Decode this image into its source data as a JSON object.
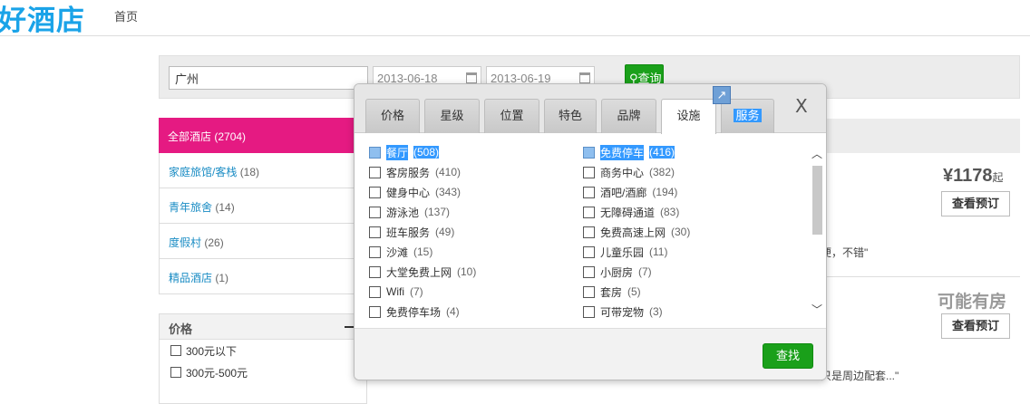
{
  "header": {
    "logo": "好酒店",
    "nav_home": "首页"
  },
  "search": {
    "city_value": "广州",
    "checkin": "2013-06-18",
    "checkout": "2013-06-19",
    "button_label": "查询"
  },
  "categories": [
    {
      "label": "全部酒店",
      "count": "(2704)"
    },
    {
      "label": "家庭旅馆/客栈",
      "count": "(18)"
    },
    {
      "label": "青年旅舍",
      "count": "(14)"
    },
    {
      "label": "度假村",
      "count": "(26)"
    },
    {
      "label": "精品酒店",
      "count": "(1)"
    }
  ],
  "price_filter": {
    "title": "价格",
    "options": [
      "300元以下",
      "300元-500元"
    ]
  },
  "results": {
    "price1": "¥1178",
    "price1_suffix": "起",
    "book_label": "查看预订",
    "review1": "便，不错\"",
    "maybe_available": "可能有房",
    "review2": "只是周边配套...\""
  },
  "modal": {
    "tabs": [
      "价格",
      "星级",
      "位置",
      "特色",
      "品牌",
      "设施",
      "服务"
    ],
    "close_label": "X",
    "options_left": [
      {
        "label": "餐厅",
        "count": "(508)"
      },
      {
        "label": "客房服务",
        "count": "(410)"
      },
      {
        "label": "健身中心",
        "count": "(343)"
      },
      {
        "label": "游泳池",
        "count": "(137)"
      },
      {
        "label": "班车服务",
        "count": "(49)"
      },
      {
        "label": "沙滩",
        "count": "(15)"
      },
      {
        "label": "大堂免费上网",
        "count": "(10)"
      },
      {
        "label": "Wifi",
        "count": "(7)"
      },
      {
        "label": "免费停车场",
        "count": "(4)"
      }
    ],
    "options_right": [
      {
        "label": "免费停车",
        "count": "(416)"
      },
      {
        "label": "商务中心",
        "count": "(382)"
      },
      {
        "label": "酒吧/酒廊",
        "count": "(194)"
      },
      {
        "label": "无障碍通道",
        "count": "(83)"
      },
      {
        "label": "免费高速上网",
        "count": "(30)"
      },
      {
        "label": "儿童乐园",
        "count": "(11)"
      },
      {
        "label": "小厨房",
        "count": "(7)"
      },
      {
        "label": "套房",
        "count": "(5)"
      },
      {
        "label": "可带宠物",
        "count": "(3)"
      }
    ],
    "find_label": "查找"
  }
}
